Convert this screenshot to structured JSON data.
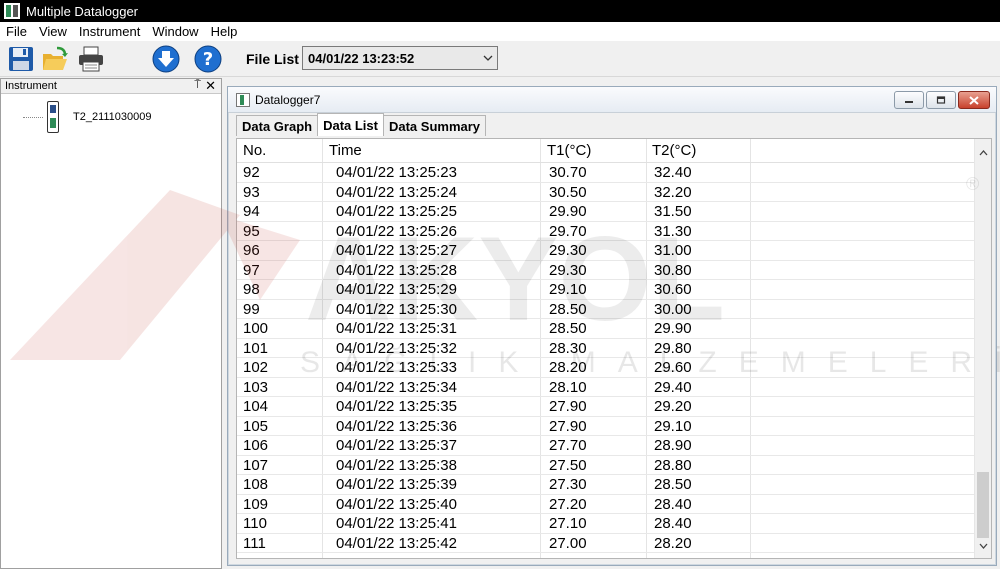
{
  "titlebar": {
    "title": "Multiple Datalogger"
  },
  "menu": [
    "File",
    "View",
    "Instrument",
    "Window",
    "Help"
  ],
  "toolbar": {
    "icons": [
      "save-icon",
      "open-folder-icon",
      "print-icon",
      "download-icon",
      "help-icon"
    ],
    "file_list_label": "File List",
    "file_list_value": "04/01/22 13:23:52"
  },
  "left_panel": {
    "header": "Instrument",
    "pin_glyph": "⍑",
    "close_glyph": "✕",
    "device_label": "T2_2111030009"
  },
  "child_window": {
    "title": "Datalogger7",
    "tabs": [
      "Data Graph",
      "Data List",
      "Data Summary"
    ],
    "active_tab": "Data List"
  },
  "table": {
    "headers": [
      "No.",
      "Time",
      "T1(°C)",
      "T2(°C)"
    ],
    "rows": [
      [
        "92",
        "04/01/22 13:25:23",
        "30.70",
        "32.40"
      ],
      [
        "93",
        "04/01/22 13:25:24",
        "30.50",
        "32.20"
      ],
      [
        "94",
        "04/01/22 13:25:25",
        "29.90",
        "31.50"
      ],
      [
        "95",
        "04/01/22 13:25:26",
        "29.70",
        "31.30"
      ],
      [
        "96",
        "04/01/22 13:25:27",
        "29.30",
        "31.00"
      ],
      [
        "97",
        "04/01/22 13:25:28",
        "29.30",
        "30.80"
      ],
      [
        "98",
        "04/01/22 13:25:29",
        "29.10",
        "30.60"
      ],
      [
        "99",
        "04/01/22 13:25:30",
        "28.50",
        "30.00"
      ],
      [
        "100",
        "04/01/22 13:25:31",
        "28.50",
        "29.90"
      ],
      [
        "101",
        "04/01/22 13:25:32",
        "28.30",
        "29.80"
      ],
      [
        "102",
        "04/01/22 13:25:33",
        "28.20",
        "29.60"
      ],
      [
        "103",
        "04/01/22 13:25:34",
        "28.10",
        "29.40"
      ],
      [
        "104",
        "04/01/22 13:25:35",
        "27.90",
        "29.20"
      ],
      [
        "105",
        "04/01/22 13:25:36",
        "27.90",
        "29.10"
      ],
      [
        "106",
        "04/01/22 13:25:37",
        "27.70",
        "28.90"
      ],
      [
        "107",
        "04/01/22 13:25:38",
        "27.50",
        "28.80"
      ],
      [
        "108",
        "04/01/22 13:25:39",
        "27.30",
        "28.50"
      ],
      [
        "109",
        "04/01/22 13:25:40",
        "27.20",
        "28.40"
      ],
      [
        "110",
        "04/01/22 13:25:41",
        "27.10",
        "28.40"
      ],
      [
        "111",
        "04/01/22 13:25:42",
        "27.00",
        "28.20"
      ]
    ]
  },
  "watermark": {
    "brand": "AKYOL",
    "subtitle": "SAĞLIK MALZEMELERİ",
    "mark": "®"
  },
  "colors": {
    "titlebar": "#000000",
    "watermark": "#c0392b"
  }
}
